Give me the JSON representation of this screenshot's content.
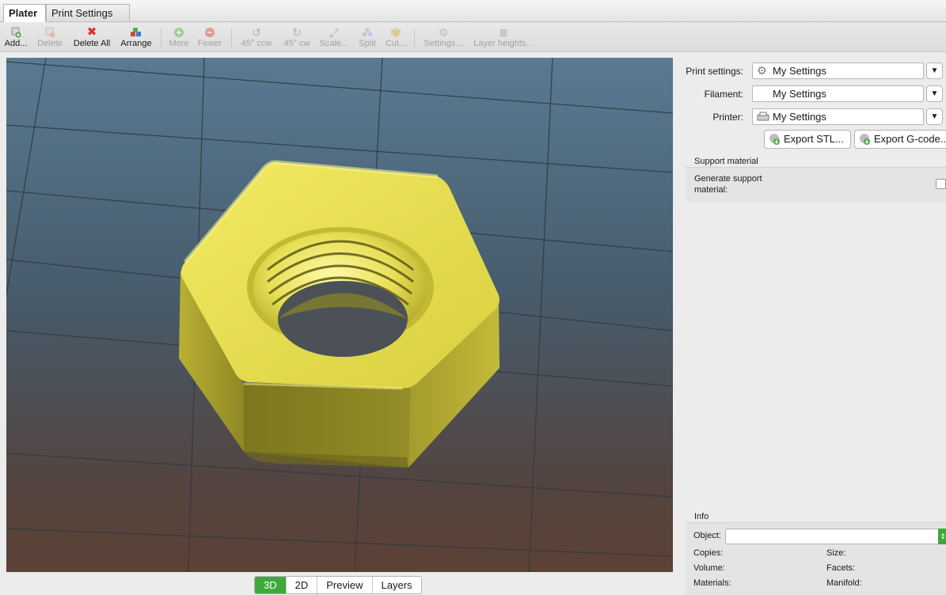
{
  "tabs": [
    {
      "label": "Plater",
      "active": true
    },
    {
      "label": "Print Settings",
      "active": false
    }
  ],
  "toolbar": {
    "items": [
      {
        "label": "Add...",
        "icon": "add-icon",
        "enabled": true
      },
      {
        "label": "Delete",
        "icon": "delete-icon",
        "enabled": false
      },
      {
        "label": "Delete All",
        "icon": "delete-all-icon",
        "enabled": true
      },
      {
        "label": "Arrange",
        "icon": "arrange-icon",
        "enabled": true
      },
      {
        "label": "More",
        "icon": "more-icon",
        "enabled": false
      },
      {
        "label": "Fewer",
        "icon": "fewer-icon",
        "enabled": false
      },
      {
        "label": "45° ccw",
        "icon": "rotate-ccw-icon",
        "enabled": false
      },
      {
        "label": "45° cw",
        "icon": "rotate-cw-icon",
        "enabled": false
      },
      {
        "label": "Scale...",
        "icon": "scale-icon",
        "enabled": false
      },
      {
        "label": "Split",
        "icon": "split-icon",
        "enabled": false
      },
      {
        "label": "Cut...",
        "icon": "cut-icon",
        "enabled": false
      },
      {
        "label": "Settings...",
        "icon": "settings-icon",
        "enabled": false
      },
      {
        "label": "Layer heights...",
        "icon": "layer-heights-icon",
        "enabled": false
      }
    ]
  },
  "view_tabs": [
    {
      "label": "3D",
      "active": true
    },
    {
      "label": "2D",
      "active": false
    },
    {
      "label": "Preview",
      "active": false
    },
    {
      "label": "Layers",
      "active": false
    }
  ],
  "settings": {
    "print_label": "Print settings:",
    "print_value": "My Settings",
    "filament_label": "Filament:",
    "filament_value": "My Settings",
    "printer_label": "Printer:",
    "printer_value": "My Settings"
  },
  "export": {
    "stl_label": "Export STL...",
    "gcode_label": "Export G-code..."
  },
  "support": {
    "title": "Support material",
    "generate_label_line1": "Generate support",
    "generate_label_line2": "material:",
    "generate_checked": false
  },
  "info": {
    "title": "Info",
    "object_label": "Object:",
    "object_value": "",
    "copies_label": "Copies:",
    "size_label": "Size:",
    "volume_label": "Volume:",
    "facets_label": "Facets:",
    "materials_label": "Materials:",
    "manifold_label": "Manifold:"
  },
  "colors": {
    "accent_green": "#3fa83a",
    "model_yellow": "#e3da4a"
  }
}
